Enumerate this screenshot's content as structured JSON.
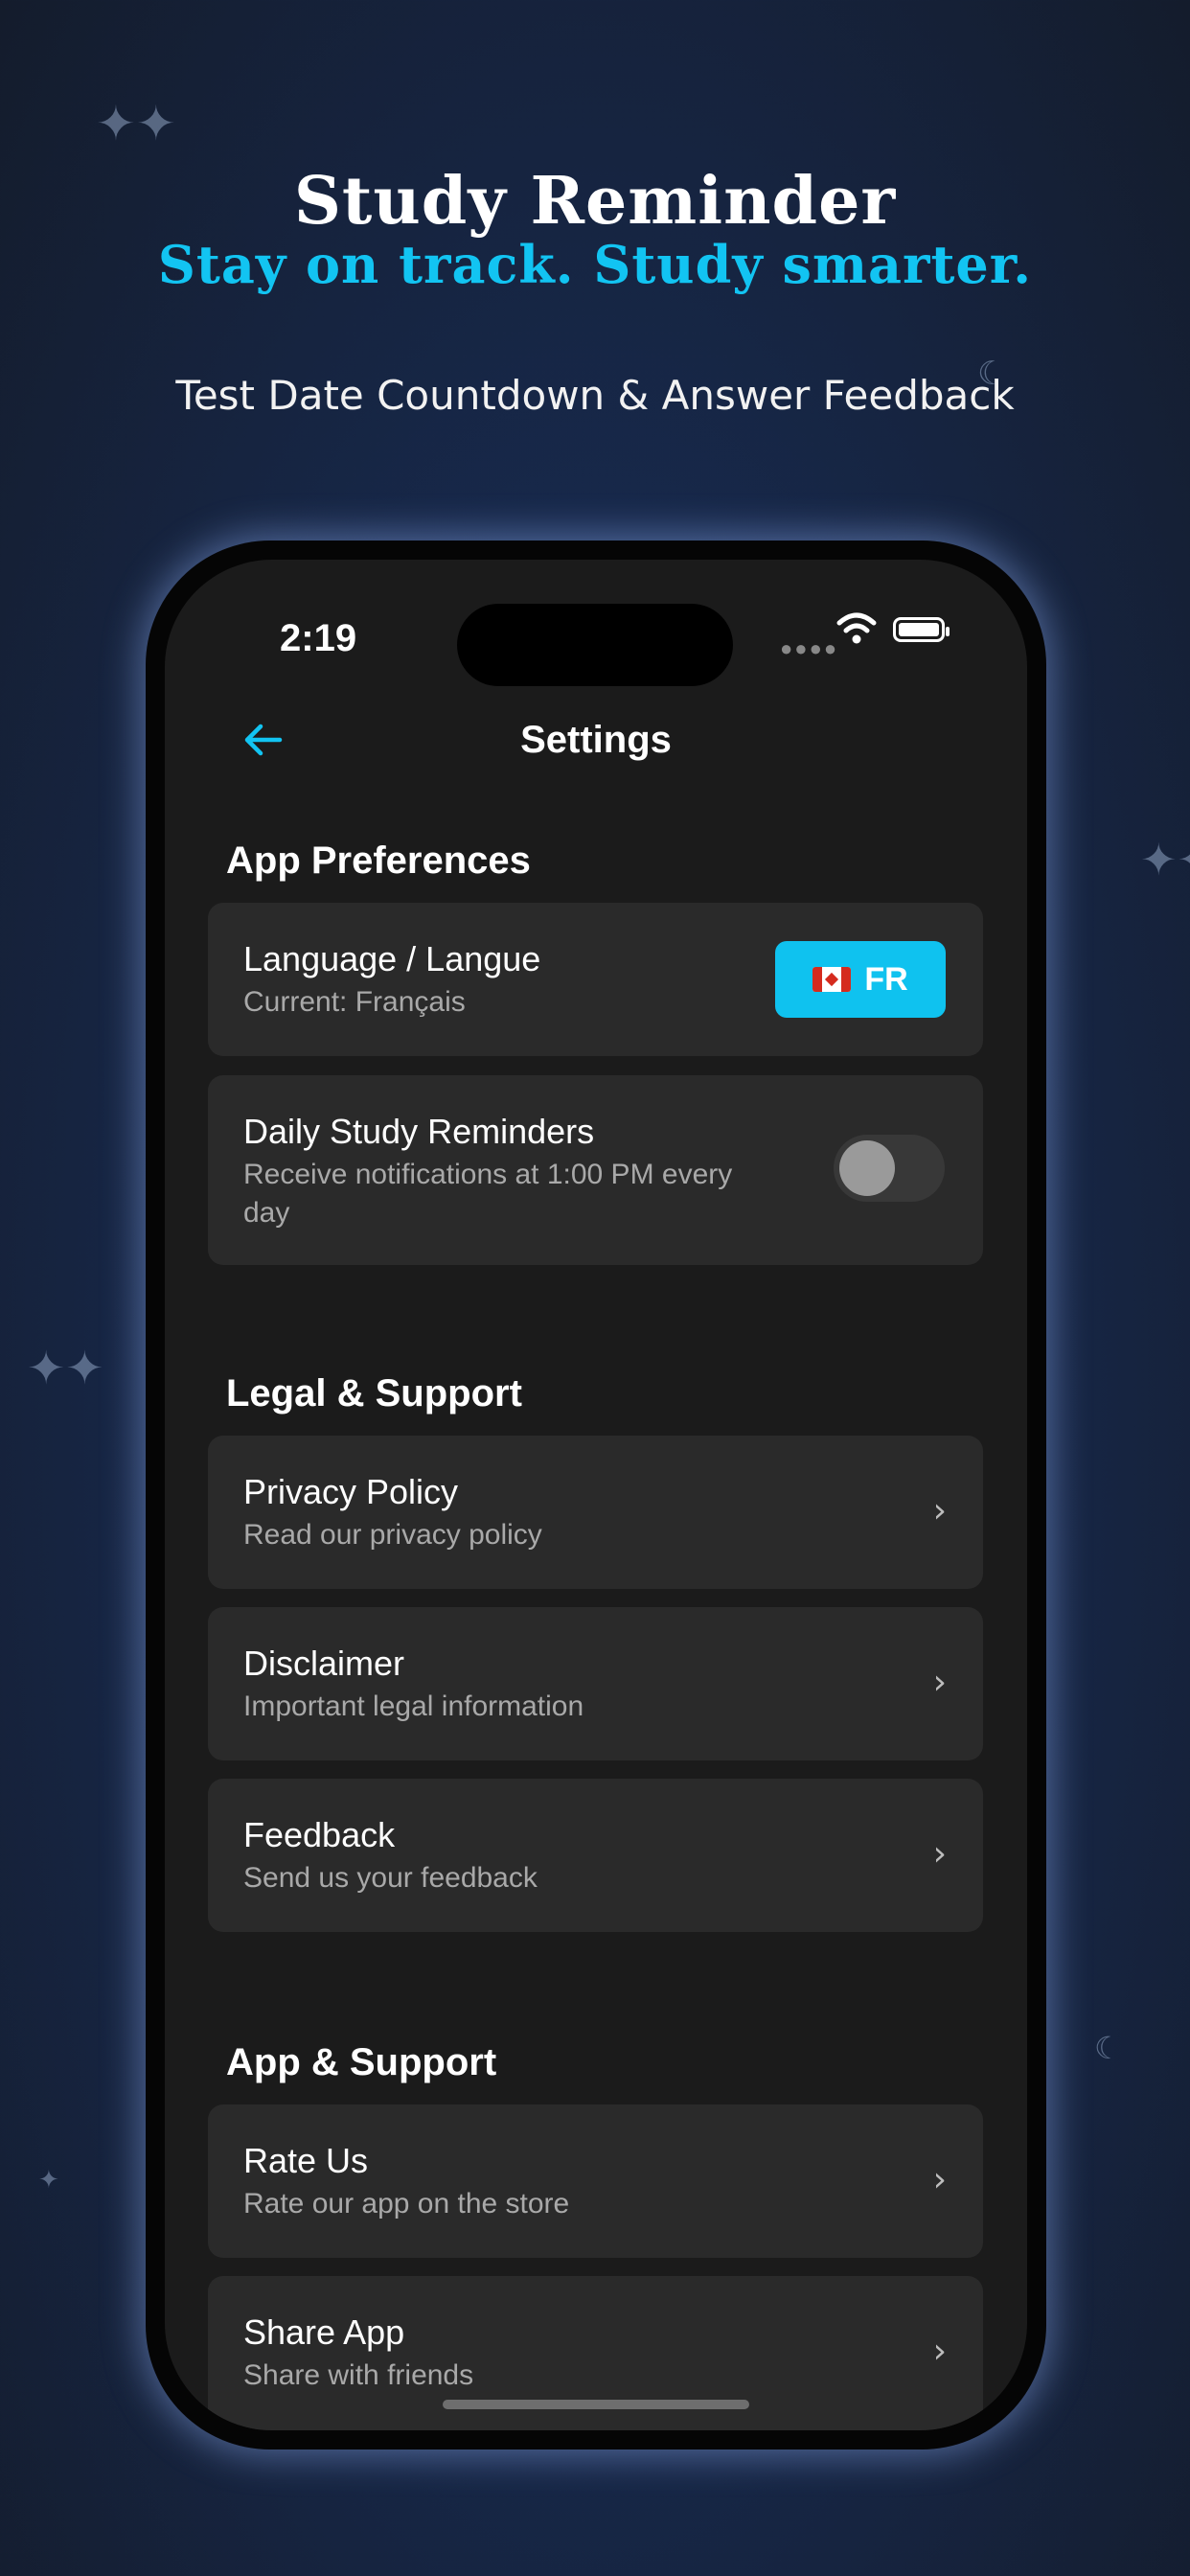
{
  "headline": {
    "title": "Study Reminder",
    "subtitle": "Stay on track. Study smarter.",
    "tagline": "Test Date Countdown & Answer Feedback"
  },
  "status_bar": {
    "time": "2:19"
  },
  "nav": {
    "title": "Settings",
    "back_icon": "arrow-left-icon"
  },
  "sections": {
    "app_preferences": {
      "header": "App Preferences",
      "language": {
        "title": "Language / Langue",
        "subtitle": "Current: Français",
        "button_label": "FR",
        "flag": "canada-flag-icon"
      },
      "reminders": {
        "title": "Daily Study Reminders",
        "subtitle_line1": "Receive notifications at 1:00 PM every",
        "subtitle_line2": "day",
        "enabled": false
      }
    },
    "legal_support": {
      "header": "Legal & Support",
      "items": [
        {
          "title": "Privacy Policy",
          "subtitle": "Read our privacy policy"
        },
        {
          "title": "Disclaimer",
          "subtitle": "Important legal information"
        },
        {
          "title": "Feedback",
          "subtitle": "Send us your feedback"
        }
      ]
    },
    "app_support": {
      "header": "App & Support",
      "items": [
        {
          "title": "Rate Us",
          "subtitle": "Rate our app on the store"
        },
        {
          "title": "Share App",
          "subtitle": "Share with friends"
        }
      ]
    }
  },
  "colors": {
    "accent": "#0fc2ef",
    "card": "#2a2a2a",
    "screen_bg": "#1b1b1b"
  }
}
